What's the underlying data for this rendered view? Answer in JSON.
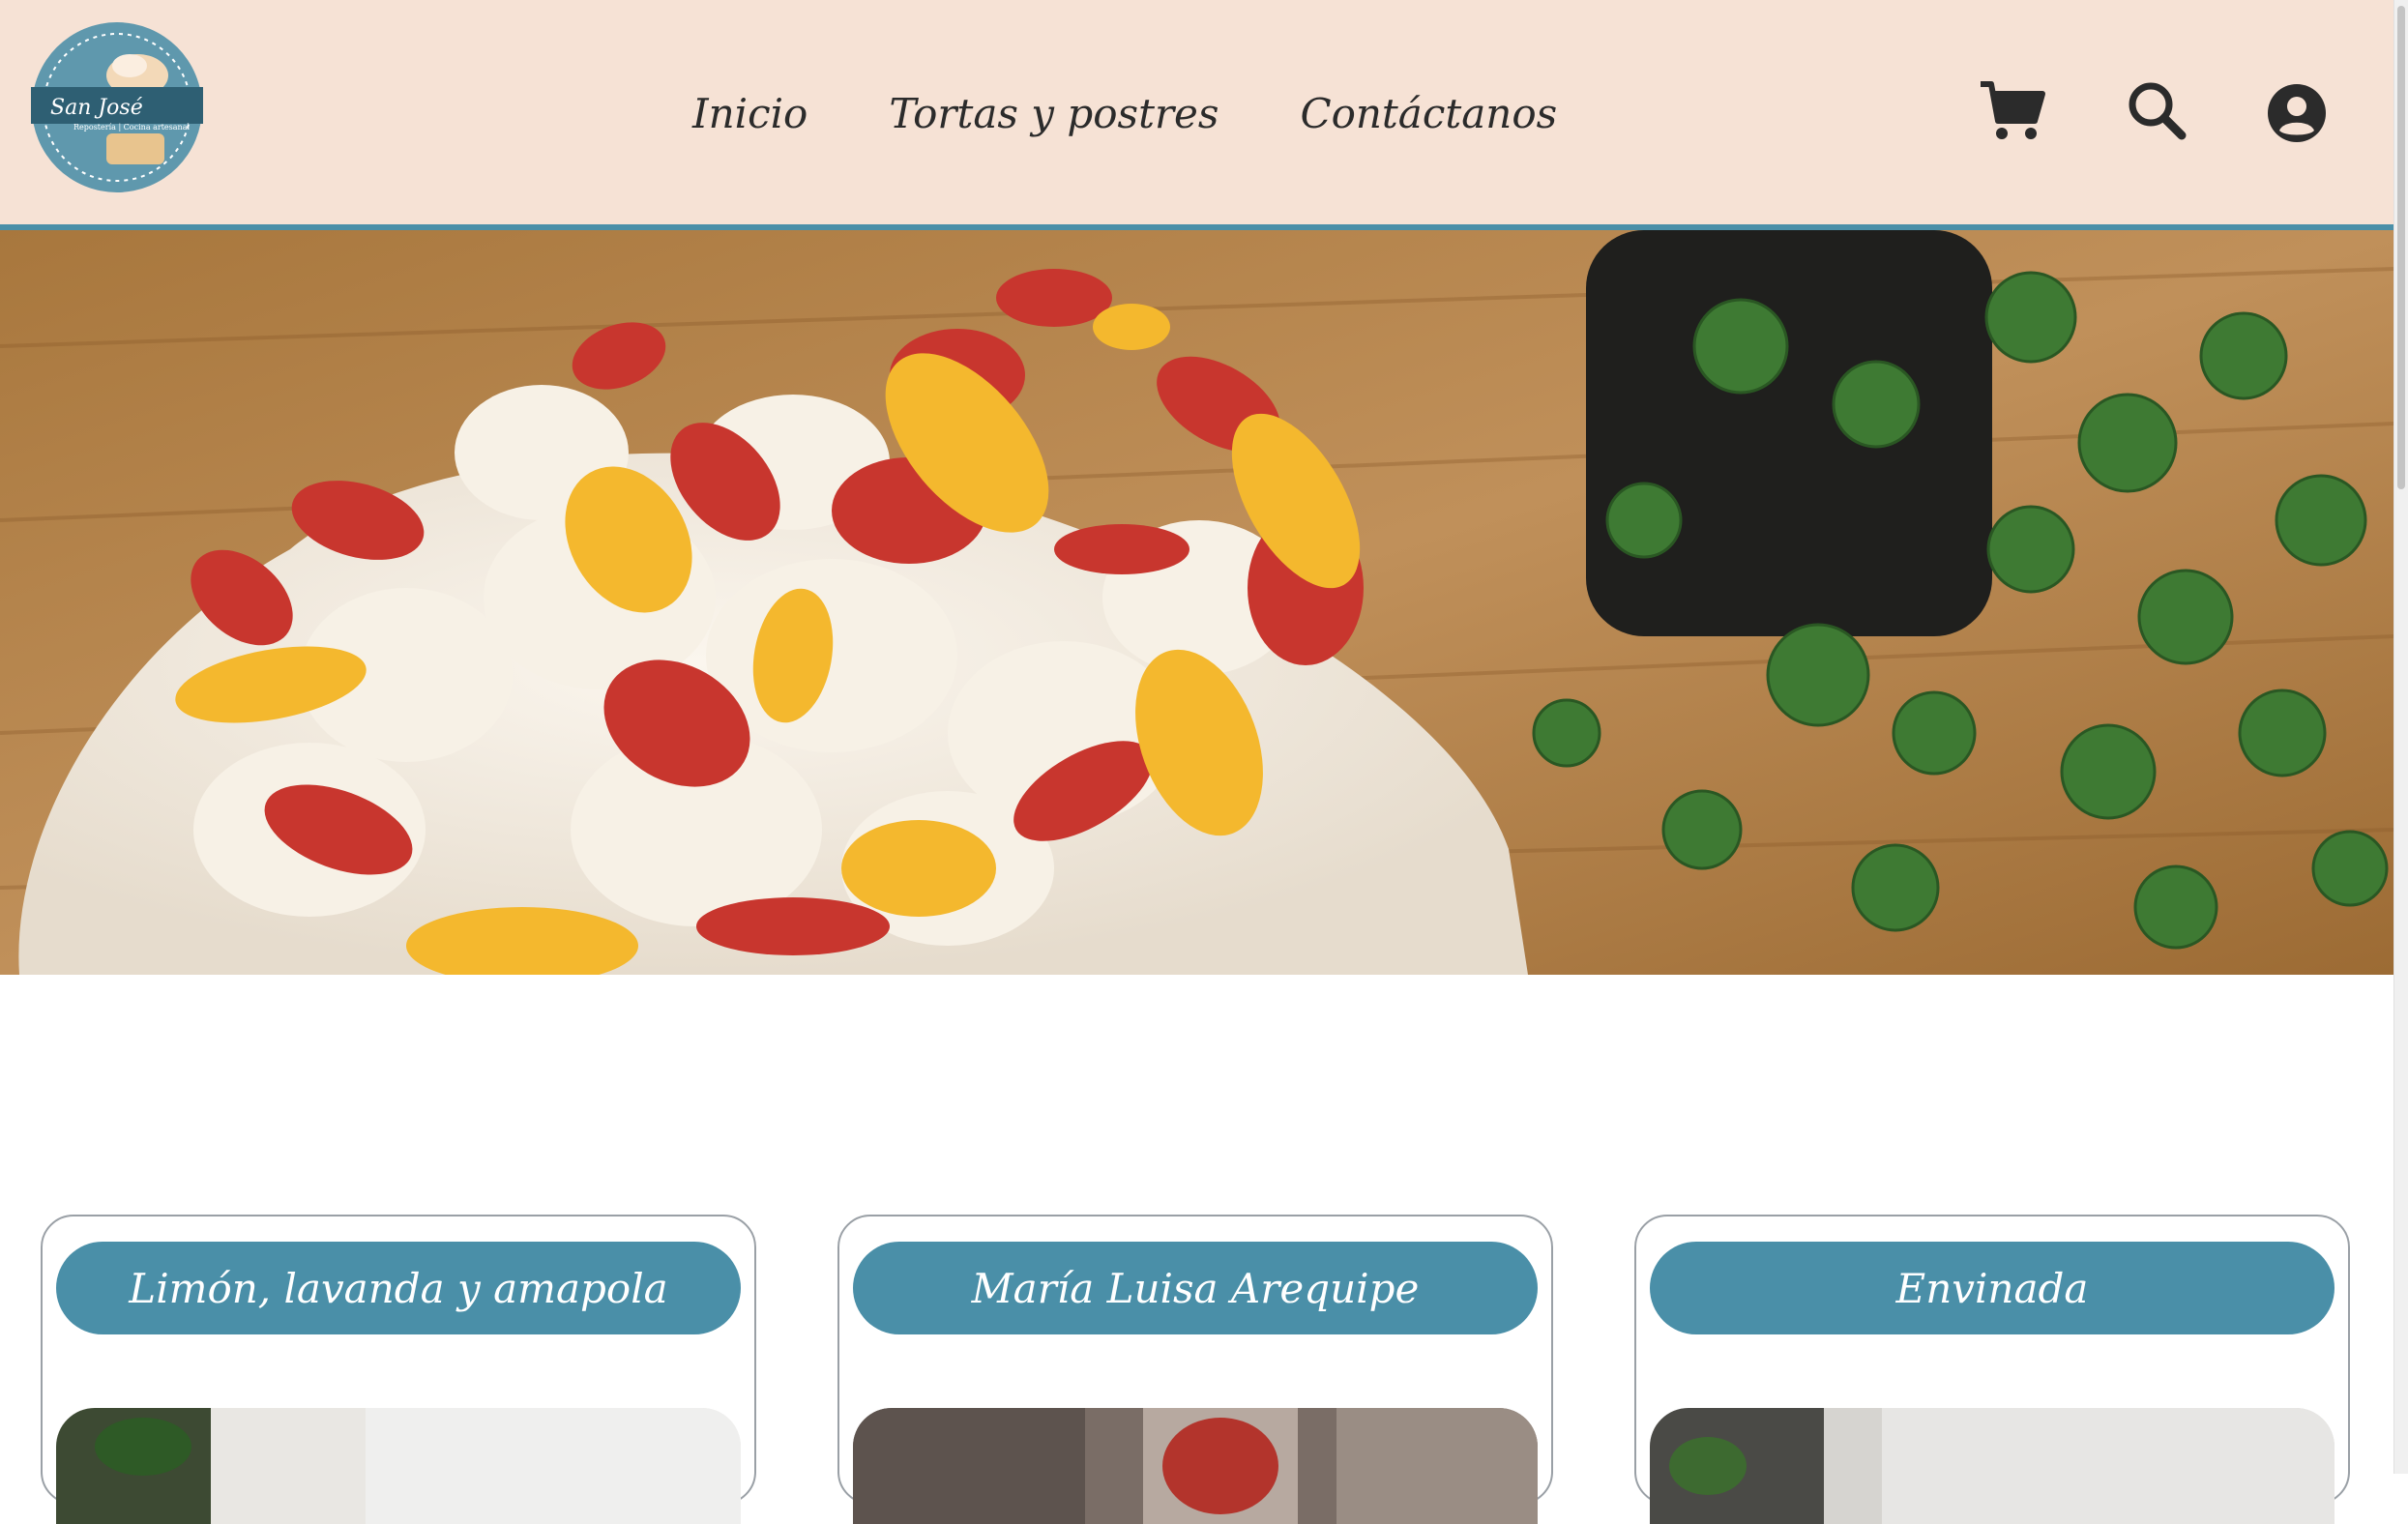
{
  "header": {
    "logo": {
      "brand": "San José",
      "tagline": "Repostería | Cocina artesanal"
    },
    "nav": [
      {
        "label": "Inicio"
      },
      {
        "label": "Tortas y postres"
      },
      {
        "label": "Contáctanos"
      }
    ],
    "icons": [
      "cart-icon",
      "search-icon",
      "user-account-icon"
    ]
  },
  "hero": {
    "image": "pavlova-with-strawberries-and-mango-beside-plant"
  },
  "products": [
    {
      "name": "Limón, lavanda y amapola"
    },
    {
      "name": "María Luisa Arequipe"
    },
    {
      "name": "Envinada"
    }
  ],
  "colors": {
    "header_bg": "#f6e2d5",
    "accent": "#4a8fa8",
    "text": "#2b2b2b"
  }
}
